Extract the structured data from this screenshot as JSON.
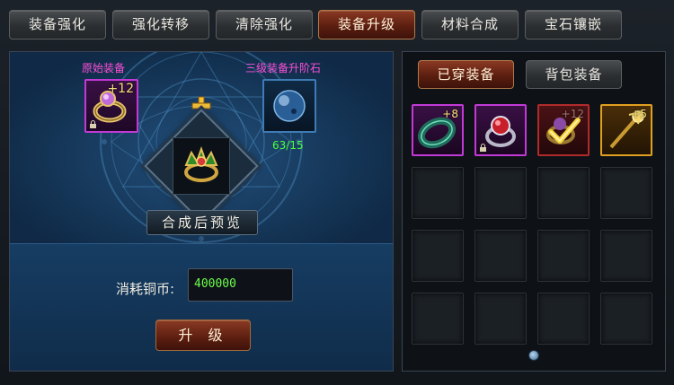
{
  "tabs": [
    {
      "label": "装备强化",
      "active": false
    },
    {
      "label": "强化转移",
      "active": false
    },
    {
      "label": "清除强化",
      "active": false
    },
    {
      "label": "装备升级",
      "active": true
    },
    {
      "label": "材料合成",
      "active": false
    },
    {
      "label": "宝石镶嵌",
      "active": false
    }
  ],
  "upgrade": {
    "origin_label": "原始装备",
    "origin_item_level": "+12",
    "stone_label": "三级装备升阶石",
    "stone_count": "63/15",
    "preview_label": "合成后预览",
    "cost_label": "消耗铜币:",
    "cost_value": "400000",
    "upgrade_button": "升 级"
  },
  "bag": {
    "tabs": [
      {
        "label": "已穿装备",
        "active": true
      },
      {
        "label": "背包装备",
        "active": false
      }
    ],
    "items": [
      {
        "name": "jade-ring",
        "level": "+8",
        "rarity_color": "#c13ad6"
      },
      {
        "name": "ruby-ring",
        "level": "",
        "rarity_color": "#c13ad6"
      },
      {
        "name": "selected-ring",
        "level": "+12",
        "rarity_color": "#b02a2a",
        "selected": true
      },
      {
        "name": "golden-staff",
        "level": "+5",
        "rarity_color": "#e0a020"
      }
    ]
  },
  "colors": {
    "accent_tab": "#6b2414",
    "label_magenta": "#ff4fd8",
    "count_green": "#4cff3a",
    "cost_green": "#6cff4a",
    "level_gold": "#f7e27a"
  }
}
